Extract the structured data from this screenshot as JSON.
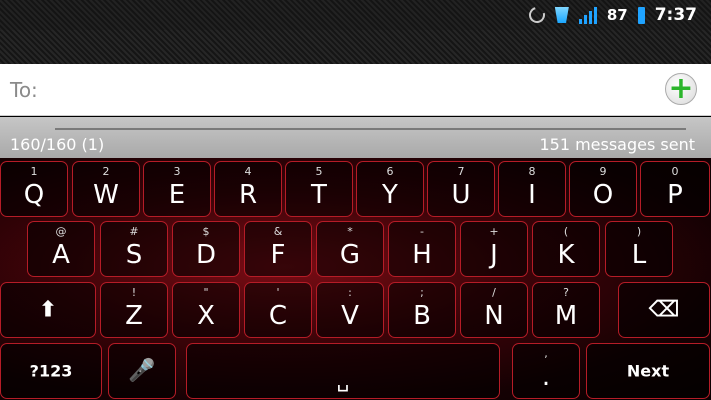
{
  "status_bar": {
    "battery": "87",
    "time": "7:37"
  },
  "compose": {
    "to_label": "To:",
    "to_value": "",
    "add_icon": "+"
  },
  "counter": {
    "chars": "160/160 (1)",
    "sent": "151 messages sent"
  },
  "keyboard": {
    "row1": [
      {
        "hint": "1",
        "label": "Q"
      },
      {
        "hint": "2",
        "label": "W"
      },
      {
        "hint": "3",
        "label": "E"
      },
      {
        "hint": "4",
        "label": "R"
      },
      {
        "hint": "5",
        "label": "T"
      },
      {
        "hint": "6",
        "label": "Y"
      },
      {
        "hint": "7",
        "label": "U"
      },
      {
        "hint": "8",
        "label": "I"
      },
      {
        "hint": "9",
        "label": "O"
      },
      {
        "hint": "0",
        "label": "P"
      }
    ],
    "row2": [
      {
        "hint": "@",
        "label": "A"
      },
      {
        "hint": "#",
        "label": "S"
      },
      {
        "hint": "$",
        "label": "D"
      },
      {
        "hint": "&",
        "label": "F"
      },
      {
        "hint": "*",
        "label": "G"
      },
      {
        "hint": "-",
        "label": "H"
      },
      {
        "hint": "+",
        "label": "J"
      },
      {
        "hint": "(",
        "label": "K"
      },
      {
        "hint": ")",
        "label": "L"
      }
    ],
    "row3": [
      {
        "hint": "!",
        "label": "Z"
      },
      {
        "hint": "\"",
        "label": "X"
      },
      {
        "hint": "'",
        "label": "C"
      },
      {
        "hint": ":",
        "label": "V"
      },
      {
        "hint": ";",
        "label": "B"
      },
      {
        "hint": "/",
        "label": "N"
      },
      {
        "hint": "?",
        "label": "M"
      }
    ],
    "shift": "⬆",
    "backspace": "⌫",
    "sym": "?123",
    "mic": "🎤",
    "space": "␣",
    "period": ".",
    "period_hint": ",",
    "next": "Next"
  },
  "colors": {
    "key_border": "#b51c27",
    "signal": "#1fa3ff",
    "add_green": "#2cb52c"
  }
}
